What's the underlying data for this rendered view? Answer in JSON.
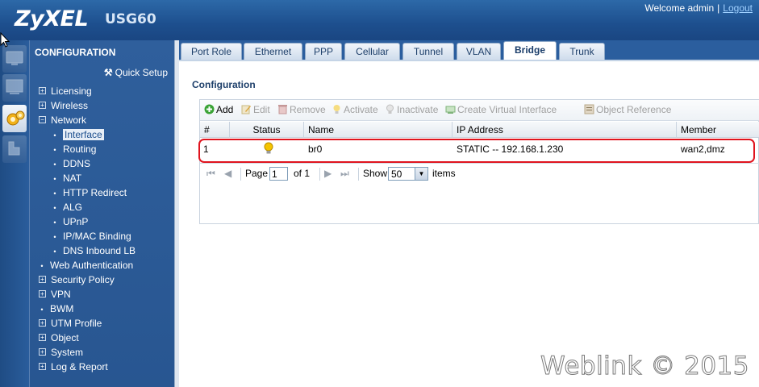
{
  "header": {
    "brand": "ZyXEL",
    "model": "USG60",
    "welcome": "Welcome admin",
    "separator": "|",
    "logout": "Logout"
  },
  "sidebar": {
    "title": "CONFIGURATION",
    "quick_setup": "Quick Setup",
    "items": [
      {
        "label": "Licensing",
        "marker": "⊞",
        "level": 1
      },
      {
        "label": "Wireless",
        "marker": "⊞",
        "level": 1
      },
      {
        "label": "Network",
        "marker": "⊟",
        "level": 1
      },
      {
        "label": "Interface",
        "marker": "•",
        "level": 2,
        "selected": true
      },
      {
        "label": "Routing",
        "marker": "•",
        "level": 2
      },
      {
        "label": "DDNS",
        "marker": "•",
        "level": 2
      },
      {
        "label": "NAT",
        "marker": "•",
        "level": 2
      },
      {
        "label": "HTTP Redirect",
        "marker": "•",
        "level": 2
      },
      {
        "label": "ALG",
        "marker": "•",
        "level": 2
      },
      {
        "label": "UPnP",
        "marker": "•",
        "level": 2
      },
      {
        "label": "IP/MAC Binding",
        "marker": "•",
        "level": 2
      },
      {
        "label": "DNS Inbound LB",
        "marker": "•",
        "level": 2
      },
      {
        "label": "Web Authentication",
        "marker": "•",
        "level": 1
      },
      {
        "label": "Security Policy",
        "marker": "⊞",
        "level": 1
      },
      {
        "label": "VPN",
        "marker": "⊞",
        "level": 1
      },
      {
        "label": "BWM",
        "marker": "•",
        "level": 1
      },
      {
        "label": "UTM Profile",
        "marker": "⊞",
        "level": 1
      },
      {
        "label": "Object",
        "marker": "⊞",
        "level": 1
      },
      {
        "label": "System",
        "marker": "⊞",
        "level": 1
      },
      {
        "label": "Log & Report",
        "marker": "⊞",
        "level": 1
      }
    ]
  },
  "tabs": [
    {
      "label": "Port Role"
    },
    {
      "label": "Ethernet"
    },
    {
      "label": "PPP"
    },
    {
      "label": "Cellular"
    },
    {
      "label": "Tunnel"
    },
    {
      "label": "VLAN"
    },
    {
      "label": "Bridge",
      "active": true
    },
    {
      "label": "Trunk"
    }
  ],
  "section_title": "Configuration",
  "toolbar": {
    "add": "Add",
    "edit": "Edit",
    "remove": "Remove",
    "activate": "Activate",
    "inactivate": "Inactivate",
    "create_virtual": "Create Virtual Interface",
    "object_reference": "Object Reference"
  },
  "table": {
    "columns": [
      "#",
      "Status",
      "Name",
      "IP Address",
      "Member"
    ],
    "rows": [
      {
        "num": "1",
        "status": "active-bulb-icon",
        "name": "br0",
        "ip": "STATIC -- 192.168.1.230",
        "member": "wan2,dmz"
      }
    ]
  },
  "pager": {
    "page_label": "Page",
    "page_value": "1",
    "of_label": "of 1",
    "show_label": "Show",
    "show_value": "50",
    "items_label": "items"
  },
  "watermark": "Weblink © 2015",
  "colors": {
    "header_blue": "#1d4f8e",
    "highlight_red": "#e0141e",
    "bulb_yellow": "#f5c400"
  }
}
